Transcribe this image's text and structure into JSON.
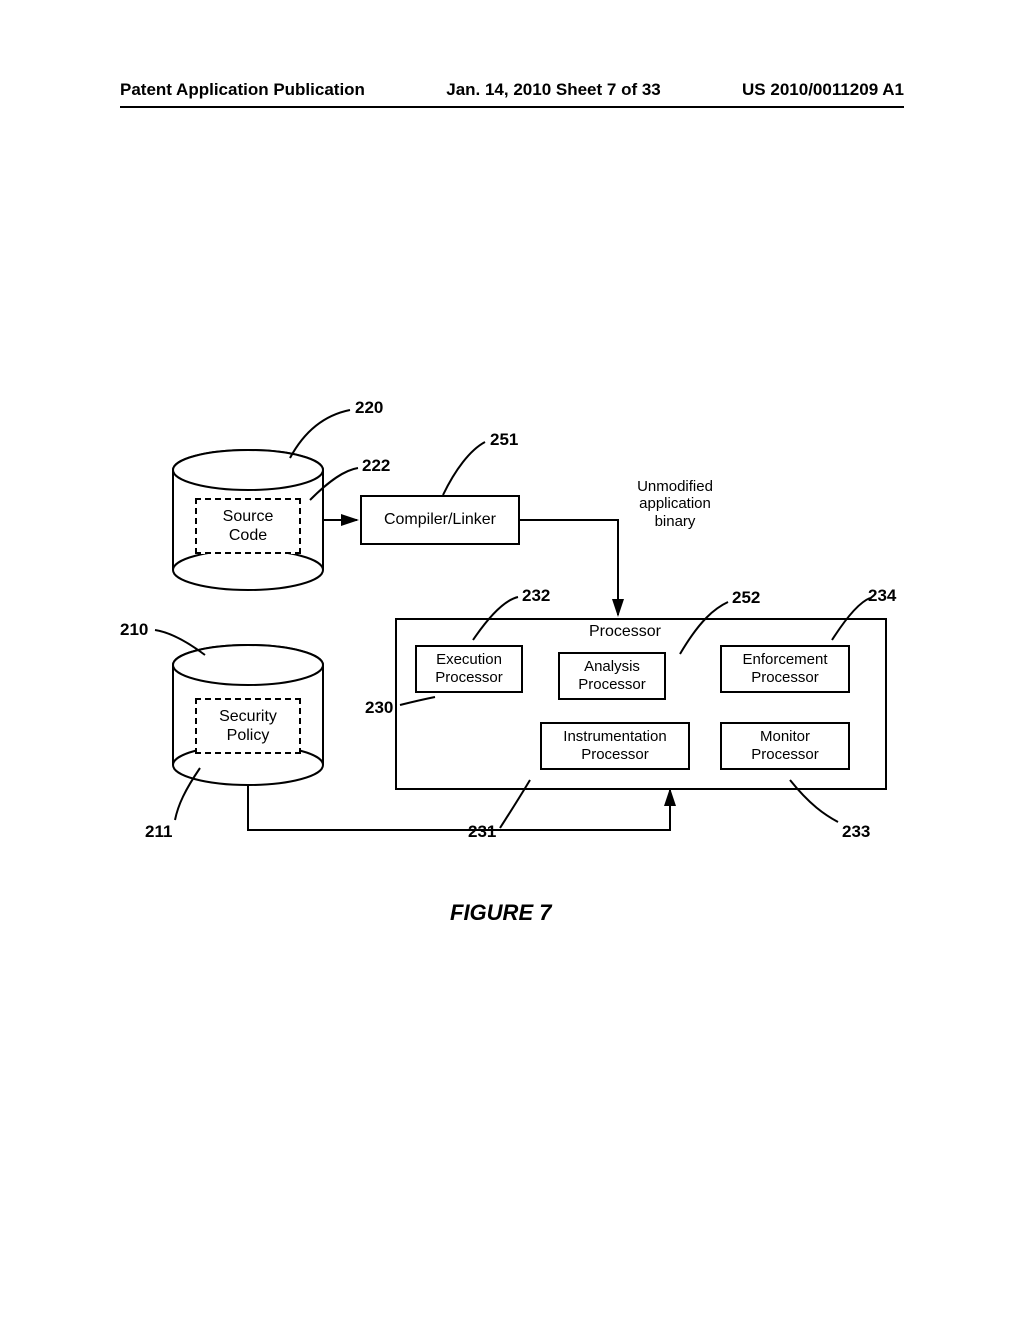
{
  "header": {
    "left": "Patent Application Publication",
    "center": "Jan. 14, 2010  Sheet 7 of 33",
    "right": "US 2010/0011209 A1"
  },
  "refs": {
    "r220": "220",
    "r222": "222",
    "r251": "251",
    "r210": "210",
    "r211": "211",
    "r230": "230",
    "r231": "231",
    "r232": "232",
    "r252": "252",
    "r233": "233",
    "r234": "234"
  },
  "labels": {
    "sourceCode": "Source\nCode",
    "compilerLinker": "Compiler/Linker",
    "unmodifiedBinary": "Unmodified\napplication\nbinary",
    "securityPolicy": "Security\nPolicy",
    "processor": "Processor",
    "executionProcessor": "Execution\nProcessor",
    "analysisProcessor": "Analysis\nProcessor",
    "enforcementProcessor": "Enforcement\nProcessor",
    "instrumentationProcessor": "Instrumentation\nProcessor",
    "monitorProcessor": "Monitor\nProcessor"
  },
  "figure": "FIGURE 7"
}
